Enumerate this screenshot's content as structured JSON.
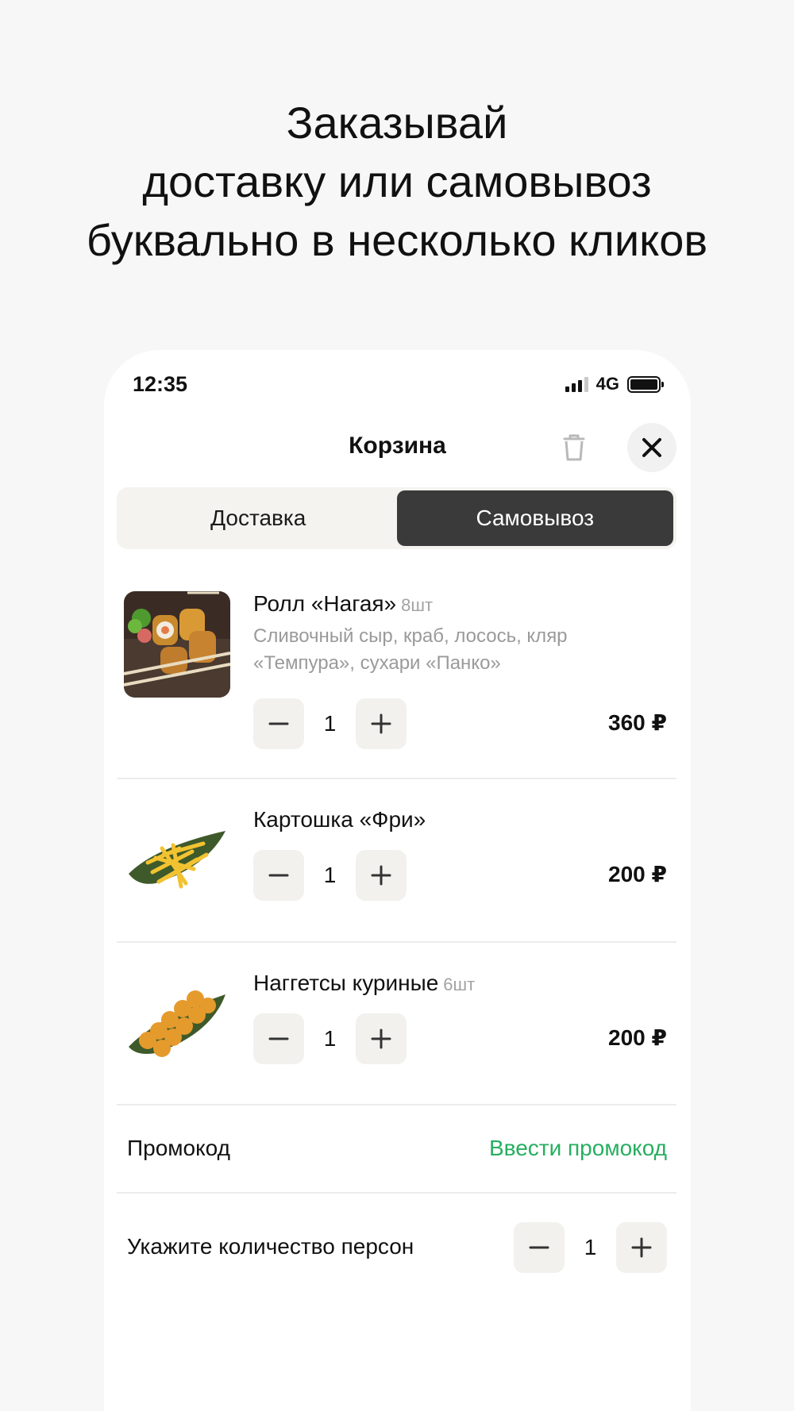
{
  "headline": [
    "Заказывай",
    "доставку или самовывоз",
    "буквально в несколько кликов"
  ],
  "status_bar": {
    "time": "12:35",
    "network": "4G"
  },
  "header": {
    "title": "Корзина"
  },
  "tabs": [
    {
      "label": "Доставка",
      "active": false
    },
    {
      "label": "Самовывоз",
      "active": true
    }
  ],
  "cart_items": [
    {
      "name": "Ролл «Нагая»",
      "unit": "8шт",
      "description": "Сливочный сыр, краб, лосось, кляр «Темпура», сухари «Панко»",
      "quantity": "1",
      "price": "360 ₽"
    },
    {
      "name": "Картошка «Фри»",
      "unit": "",
      "description": "",
      "quantity": "1",
      "price": "200 ₽"
    },
    {
      "name": "Наггетсы куриные",
      "unit": "6шт",
      "description": "",
      "quantity": "1",
      "price": "200 ₽"
    }
  ],
  "promo": {
    "label": "Промокод",
    "link": "Ввести промокод"
  },
  "persons": {
    "label": "Укажите количество персон",
    "quantity": "1"
  },
  "colors": {
    "accent_green": "#27ae60",
    "active_tab": "#3a3a3a",
    "background": "#f7f7f7"
  }
}
